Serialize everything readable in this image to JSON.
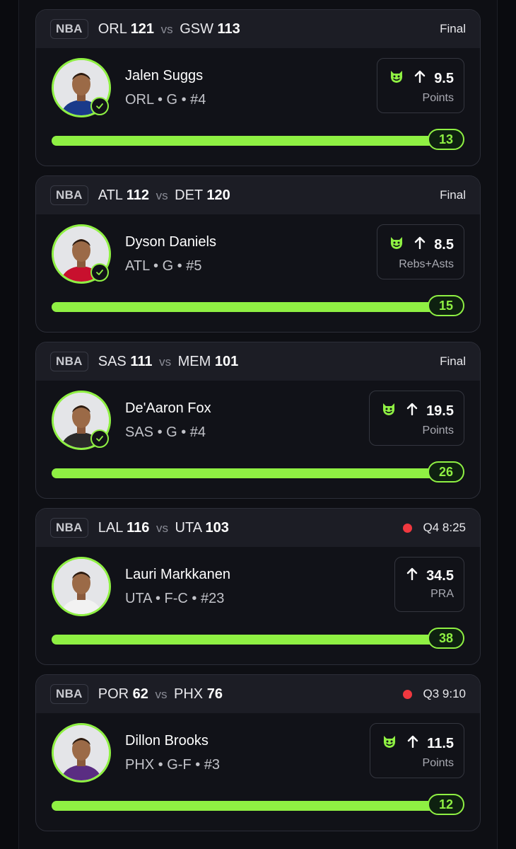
{
  "accent_color": "#8ff043",
  "live_color": "#f0383f",
  "cards": [
    {
      "league": "NBA",
      "away_team": "ORL",
      "away_score": "121",
      "vs": "vs",
      "home_team": "GSW",
      "home_score": "113",
      "status": "Final",
      "live": false,
      "player_name": "Jalen Suggs",
      "player_meta": "ORL • G • #4",
      "verified": true,
      "imp_icon": "imp-face-icon",
      "line": "9.5",
      "stat": "Points",
      "result": "13",
      "progress": 1.0,
      "jersey_color": "#1a3a8a"
    },
    {
      "league": "NBA",
      "away_team": "ATL",
      "away_score": "112",
      "vs": "vs",
      "home_team": "DET",
      "home_score": "120",
      "status": "Final",
      "live": false,
      "player_name": "Dyson Daniels",
      "player_meta": "ATL • G • #5",
      "verified": true,
      "imp_icon": "imp-face-icon",
      "line": "8.5",
      "stat": "Rebs+Asts",
      "result": "15",
      "progress": 1.0,
      "jersey_color": "#c8102e"
    },
    {
      "league": "NBA",
      "away_team": "SAS",
      "away_score": "111",
      "vs": "vs",
      "home_team": "MEM",
      "home_score": "101",
      "status": "Final",
      "live": false,
      "player_name": "De'Aaron Fox",
      "player_meta": "SAS • G • #4",
      "verified": true,
      "imp_icon": "imp-face-icon",
      "line": "19.5",
      "stat": "Points",
      "result": "26",
      "progress": 1.0,
      "jersey_color": "#2a2a2a"
    },
    {
      "league": "NBA",
      "away_team": "LAL",
      "away_score": "116",
      "vs": "vs",
      "home_team": "UTA",
      "home_score": "103",
      "status": "Q4 8:25",
      "live": true,
      "player_name": "Lauri Markkanen",
      "player_meta": "UTA • F-C • #23",
      "verified": false,
      "imp_icon": null,
      "line": "34.5",
      "stat": "PRA",
      "result": "38",
      "progress": 1.0,
      "jersey_color": "#f2f2f2"
    },
    {
      "league": "NBA",
      "away_team": "POR",
      "away_score": "62",
      "vs": "vs",
      "home_team": "PHX",
      "home_score": "76",
      "status": "Q3 9:10",
      "live": true,
      "player_name": "Dillon Brooks",
      "player_meta": "PHX • G-F • #3",
      "verified": false,
      "imp_icon": "imp-face-icon",
      "line": "11.5",
      "stat": "Points",
      "result": "12",
      "progress": 1.0,
      "jersey_color": "#5a2d82"
    }
  ]
}
